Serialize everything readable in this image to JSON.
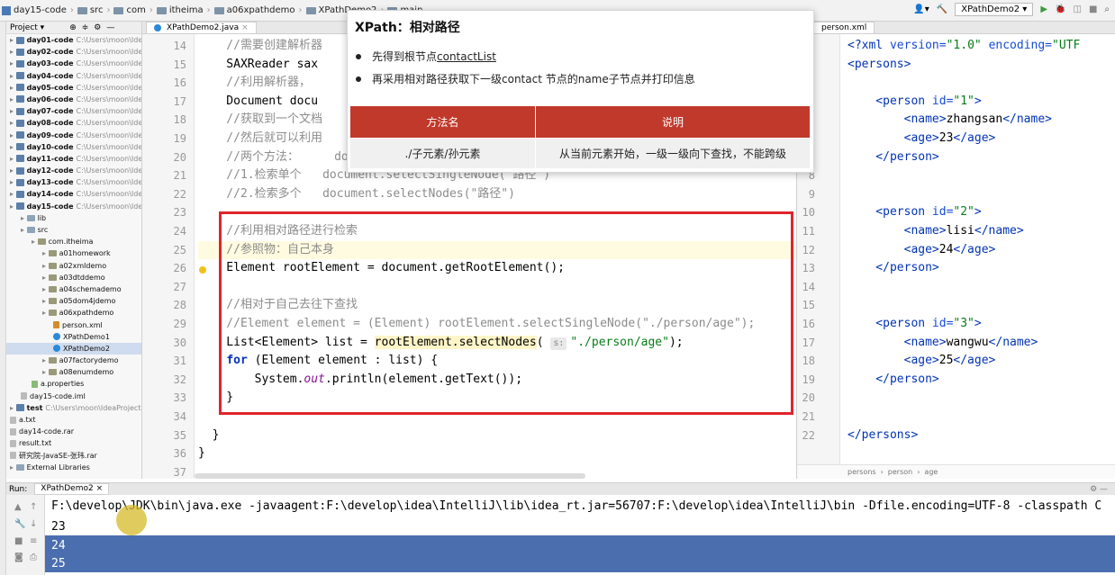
{
  "breadcrumb": {
    "items": [
      "day15-code",
      "src",
      "com",
      "itheima",
      "a06xpathdemo",
      "XPathDemo2",
      "main"
    ]
  },
  "toolbar": {
    "run_config": "XPathDemo2"
  },
  "project": {
    "header": "Project",
    "rows": [
      {
        "label": "day01-code",
        "hint": "C:\\Users\\moon\\Idea",
        "type": "mod",
        "indent": 0
      },
      {
        "label": "day02-code",
        "hint": "C:\\Users\\moon\\Idea",
        "type": "mod",
        "indent": 0
      },
      {
        "label": "day03-code",
        "hint": "C:\\Users\\moon\\Idea",
        "type": "mod",
        "indent": 0
      },
      {
        "label": "day04-code",
        "hint": "C:\\Users\\moon\\Idea",
        "type": "mod",
        "indent": 0
      },
      {
        "label": "day05-code",
        "hint": "C:\\Users\\moon\\Idea",
        "type": "mod",
        "indent": 0
      },
      {
        "label": "day06-code",
        "hint": "C:\\Users\\moon\\Idea",
        "type": "mod",
        "indent": 0
      },
      {
        "label": "day07-code",
        "hint": "C:\\Users\\moon\\Idea",
        "type": "mod",
        "indent": 0
      },
      {
        "label": "day08-code",
        "hint": "C:\\Users\\moon\\Idea",
        "type": "mod",
        "indent": 0
      },
      {
        "label": "day09-code",
        "hint": "C:\\Users\\moon\\Idea",
        "type": "mod",
        "indent": 0
      },
      {
        "label": "day10-code",
        "hint": "C:\\Users\\moon\\Idea",
        "type": "mod",
        "indent": 0
      },
      {
        "label": "day11-code",
        "hint": "C:\\Users\\moon\\Idea",
        "type": "mod",
        "indent": 0
      },
      {
        "label": "day12-code",
        "hint": "C:\\Users\\moon\\Idea",
        "type": "mod",
        "indent": 0
      },
      {
        "label": "day13-code",
        "hint": "C:\\Users\\moon\\Idea",
        "type": "mod",
        "indent": 0
      },
      {
        "label": "day14-code",
        "hint": "C:\\Users\\moon\\Idea",
        "type": "mod",
        "indent": 0
      },
      {
        "label": "day15-code",
        "hint": "C:\\Users\\moon\\Idea",
        "type": "mod",
        "indent": 0
      },
      {
        "label": "lib",
        "hint": "",
        "type": "dir",
        "indent": 1
      },
      {
        "label": "src",
        "hint": "",
        "type": "dir",
        "indent": 1
      },
      {
        "label": "com.itheima",
        "hint": "",
        "type": "pkg",
        "indent": 2
      },
      {
        "label": "a01homework",
        "hint": "",
        "type": "pkg",
        "indent": 3
      },
      {
        "label": "a02xmldemo",
        "hint": "",
        "type": "pkg",
        "indent": 3
      },
      {
        "label": "a03dtddemo",
        "hint": "",
        "type": "pkg",
        "indent": 3
      },
      {
        "label": "a04schemademo",
        "hint": "",
        "type": "pkg",
        "indent": 3
      },
      {
        "label": "a05dom4jdemo",
        "hint": "",
        "type": "pkg",
        "indent": 3
      },
      {
        "label": "a06xpathdemo",
        "hint": "",
        "type": "pkg",
        "indent": 3
      },
      {
        "label": "person.xml",
        "hint": "",
        "type": "xml",
        "indent": 4
      },
      {
        "label": "XPathDemo1",
        "hint": "",
        "type": "java",
        "indent": 4
      },
      {
        "label": "XPathDemo2",
        "hint": "",
        "type": "java",
        "indent": 4,
        "selected": true
      },
      {
        "label": "a07factorydemo",
        "hint": "",
        "type": "pkg",
        "indent": 3
      },
      {
        "label": "a08enumdemo",
        "hint": "",
        "type": "pkg",
        "indent": 3
      },
      {
        "label": "a.properties",
        "hint": "",
        "type": "prop",
        "indent": 2
      },
      {
        "label": "day15-code.iml",
        "hint": "",
        "type": "txt",
        "indent": 1
      },
      {
        "label": "test",
        "hint": "C:\\Users\\moon\\IdeaProjects",
        "type": "mod",
        "indent": 0
      },
      {
        "label": "a.txt",
        "hint": "",
        "type": "txt",
        "indent": 0
      },
      {
        "label": "day14-code.rar",
        "hint": "",
        "type": "txt",
        "indent": 0
      },
      {
        "label": "result.txt",
        "hint": "",
        "type": "txt",
        "indent": 0
      },
      {
        "label": "研究院-JavaSE-张玮.rar",
        "hint": "",
        "type": "txt",
        "indent": 0
      },
      {
        "label": "External Libraries",
        "hint": "",
        "type": "dir",
        "indent": 0
      }
    ]
  },
  "editor": {
    "tab": "XPathDemo2.java",
    "lines": [
      {
        "n": "14",
        "code": "    //需要创建解析器"
      },
      {
        "n": "15",
        "code": "    SAXReader sax"
      },
      {
        "n": "16",
        "code": "    //利用解析器，"
      },
      {
        "n": "17",
        "code": "    Document docu"
      },
      {
        "n": "18",
        "code": "    //获取到一个文档"
      },
      {
        "n": "19",
        "code": "    //然后就可以利用"
      },
      {
        "n": "20",
        "code": "    //两个方法：     document.selectSingleNode(\"路径\")"
      },
      {
        "n": "21",
        "code": "    //1.检索单个   document.selectSingleNode(\"路径\")"
      },
      {
        "n": "22",
        "code": "    //2.检索多个   document.selectNodes(\"路径\")"
      },
      {
        "n": "23",
        "code": ""
      },
      {
        "n": "24",
        "code": "    //利用相对路径进行检索"
      },
      {
        "n": "25",
        "code": "    //参照物：自己本身"
      },
      {
        "n": "26",
        "code": "    Element rootElement = document.getRootElement();"
      },
      {
        "n": "27",
        "code": ""
      },
      {
        "n": "28",
        "code": "    //相对于自己去往下查找"
      },
      {
        "n": "29",
        "code": "    //Element element = (Element) rootElement.selectSingleNode(\"./person/age\");"
      },
      {
        "n": "30",
        "code": "    List<Element> list = rootElement.selectNodes( s: \"./person/age\");"
      },
      {
        "n": "31",
        "code": "    for (Element element : list) {"
      },
      {
        "n": "32",
        "code": "        System.out.println(element.getText());"
      },
      {
        "n": "33",
        "code": "    }"
      },
      {
        "n": "34",
        "code": ""
      },
      {
        "n": "35",
        "code": "  }"
      },
      {
        "n": "36",
        "code": "}"
      },
      {
        "n": "37",
        "code": ""
      }
    ]
  },
  "xml": {
    "tab": "person.xml",
    "lines": [
      {
        "n": "",
        "code": "<?xml version=\"1.0\" encoding=\"UTF"
      },
      {
        "n": "",
        "code": "<persons>"
      },
      {
        "n": "",
        "code": ""
      },
      {
        "n": "",
        "code": "    <person id=\"1\">"
      },
      {
        "n": "",
        "code": "        <name>zhangsan</name>"
      },
      {
        "n": "",
        "code": "        <age>23</age>"
      },
      {
        "n": "",
        "code": "    </person>"
      },
      {
        "n": "8",
        "code": ""
      },
      {
        "n": "9",
        "code": ""
      },
      {
        "n": "10",
        "code": "    <person id=\"2\">"
      },
      {
        "n": "11",
        "code": "        <name>lisi</name>"
      },
      {
        "n": "12",
        "code": "        <age>24</age>"
      },
      {
        "n": "13",
        "code": "    </person>"
      },
      {
        "n": "14",
        "code": ""
      },
      {
        "n": "15",
        "code": ""
      },
      {
        "n": "16",
        "code": "    <person id=\"3\">"
      },
      {
        "n": "17",
        "code": "        <name>wangwu</name>"
      },
      {
        "n": "18",
        "code": "        <age>25</age>"
      },
      {
        "n": "19",
        "code": "    </person>"
      },
      {
        "n": "20",
        "code": ""
      },
      {
        "n": "21",
        "code": ""
      },
      {
        "n": "22",
        "code": "</persons>"
      }
    ],
    "status": [
      "persons",
      "person",
      "age"
    ]
  },
  "popup": {
    "title": "XPath：相对路径",
    "bullet1_prefix": "先得到根节点",
    "bullet1_link": "contactList",
    "bullet2": "再采用相对路径获取下一级contact 节点的name子节点并打印信息",
    "table": {
      "headers": [
        "方法名",
        "说明"
      ],
      "rows": [
        [
          "./子元素/孙元素",
          "从当前元素开始，一级一级向下查找，不能跨级"
        ]
      ]
    }
  },
  "run": {
    "label": "Run:",
    "tab": "XPathDemo2",
    "command": "F:\\develop\\JDK\\bin\\java.exe -javaagent:F:\\develop\\idea\\IntelliJ\\lib\\idea_rt.jar=56707:F:\\develop\\idea\\IntelliJ\\bin -Dfile.encoding=UTF-8 -classpath C",
    "outputs": [
      "23",
      "24",
      "25"
    ]
  },
  "colors": {
    "accent_red": "#e0242c",
    "table_header": "#c0392b",
    "selection": "#4b6eaf"
  }
}
